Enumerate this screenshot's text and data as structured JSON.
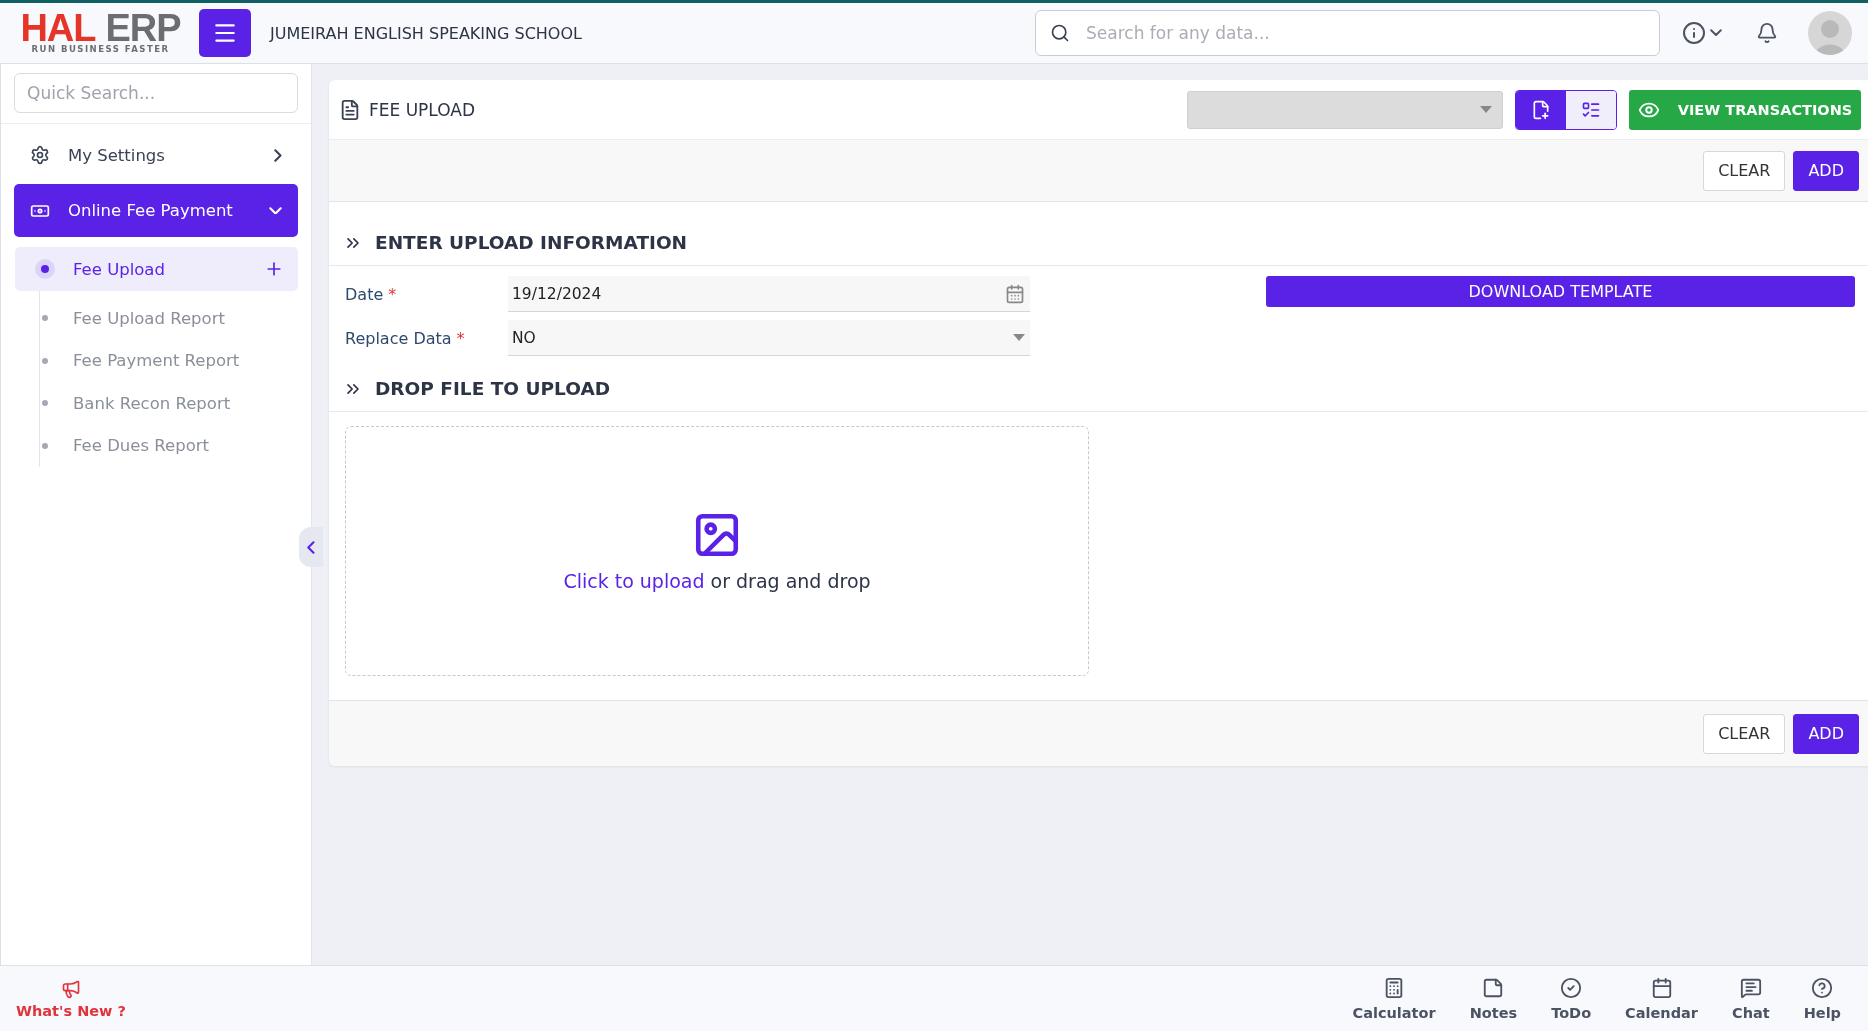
{
  "header": {
    "logo": {
      "brand_main": "HAL",
      "brand_accent": "ERP",
      "tagline": "RUN BUSINESS FASTER"
    },
    "school_name": "JUMEIRAH ENGLISH SPEAKING SCHOOL",
    "search": {
      "placeholder": "Search for any data..."
    }
  },
  "sidebar": {
    "search": {
      "placeholder": "Quick Search..."
    },
    "items": [
      {
        "label": "My Settings",
        "kind": "settings",
        "expanded": false,
        "selected": false
      },
      {
        "label": "Online Fee Payment",
        "kind": "payment",
        "expanded": true,
        "selected": true,
        "children": [
          {
            "label": "Fee Upload",
            "selected": true
          },
          {
            "label": "Fee Upload Report",
            "selected": false
          },
          {
            "label": "Fee Payment Report",
            "selected": false
          },
          {
            "label": "Bank Recon Report",
            "selected": false
          },
          {
            "label": "Fee Dues Report",
            "selected": false
          }
        ]
      }
    ]
  },
  "page": {
    "title": "FEE UPLOAD",
    "view_toggle": [
      {
        "kind": "add",
        "selected": true
      },
      {
        "kind": "edit",
        "selected": false
      }
    ],
    "view_transactions": "VIEW TRANSACTIONS",
    "top_actions": [
      "CLEAR",
      "ADD"
    ],
    "sections": [
      {
        "title": "ENTER UPLOAD INFORMATION"
      },
      {
        "title": "DROP FILE TO UPLOAD"
      }
    ],
    "fields": [
      {
        "label": "Date",
        "required_mark": "*",
        "kind": "date",
        "value": "19/12/2024"
      },
      {
        "label": "Replace Data",
        "required_mark": "*",
        "kind": "select",
        "value": "NO"
      }
    ],
    "download_template": "DOWNLOAD TEMPLATE",
    "dropzone": {
      "link": "Click to upload",
      "text": "or drag and drop"
    },
    "bottom_actions": [
      "CLEAR",
      "ADD"
    ]
  },
  "footer": {
    "whats_new": "What's New ?",
    "tools": [
      {
        "label": "Calculator",
        "kind": "calculator"
      },
      {
        "label": "Notes",
        "kind": "notes"
      },
      {
        "label": "ToDo",
        "kind": "todo"
      },
      {
        "label": "Calendar",
        "kind": "calendar"
      },
      {
        "label": "Chat",
        "kind": "chat"
      },
      {
        "label": "Help",
        "kind": "help"
      }
    ]
  }
}
